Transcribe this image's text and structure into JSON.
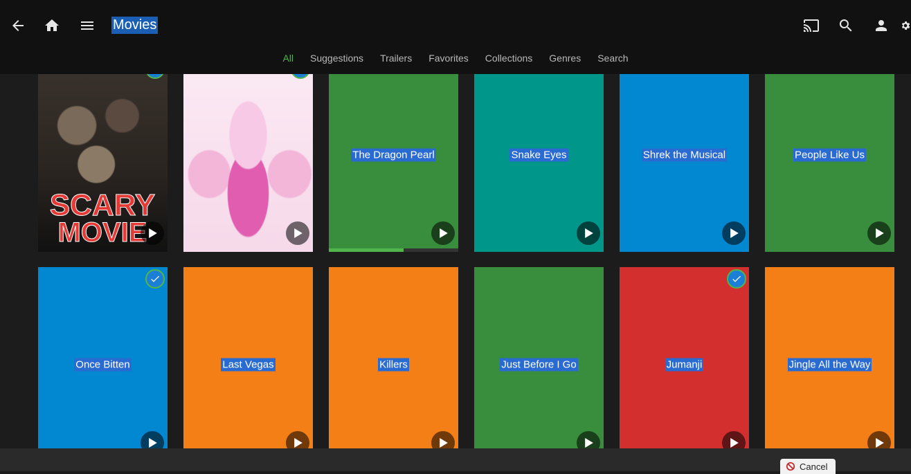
{
  "header": {
    "title": "Movies",
    "icons": [
      "back-arrow-icon",
      "home-icon",
      "menu-icon",
      "cast-icon",
      "search-icon",
      "user-icon",
      "settings-icon"
    ]
  },
  "tabs": [
    {
      "label": "All",
      "active": true
    },
    {
      "label": "Suggestions",
      "active": false
    },
    {
      "label": "Trailers",
      "active": false
    },
    {
      "label": "Favorites",
      "active": false
    },
    {
      "label": "Collections",
      "active": false
    },
    {
      "label": "Genres",
      "active": false
    },
    {
      "label": "Search",
      "active": false
    }
  ],
  "rows": [
    {
      "cards": [
        {
          "title": "",
          "poster": "scary-movie",
          "color": "#1a1a1a",
          "watched": true,
          "progress": null
        },
        {
          "title": "",
          "poster": "legally-blonde",
          "color": "#f3e6f2",
          "watched": true,
          "progress": null
        },
        {
          "title": "The Dragon Pearl",
          "color": "#388e3c",
          "watched": false,
          "progress": 0.58
        },
        {
          "title": "Snake Eyes",
          "color": "#00968a",
          "watched": false,
          "progress": null
        },
        {
          "title": "Shrek the Musical",
          "color": "#0288d1",
          "watched": false,
          "progress": null
        },
        {
          "title": "People Like Us",
          "color": "#388e3c",
          "watched": false,
          "progress": null
        }
      ]
    },
    {
      "cards": [
        {
          "title": "Once Bitten",
          "color": "#0288d1",
          "watched": true,
          "progress": null
        },
        {
          "title": "Last Vegas",
          "color": "#f57f17",
          "watched": false,
          "progress": null
        },
        {
          "title": "Killers",
          "color": "#f57f17",
          "watched": false,
          "progress": null
        },
        {
          "title": "Just Before I Go",
          "color": "#388e3c",
          "watched": false,
          "progress": null
        },
        {
          "title": "Jumanji",
          "color": "#d32f2f",
          "watched": true,
          "progress": null
        },
        {
          "title": "Jingle All the Way",
          "color": "#f57f17",
          "watched": false,
          "progress": null
        }
      ]
    }
  ],
  "footer": {
    "cancel_label": "Cancel"
  },
  "colors": {
    "accent": "#52b54b",
    "header_bg": "#111111",
    "page_bg": "#1c1c1c"
  }
}
